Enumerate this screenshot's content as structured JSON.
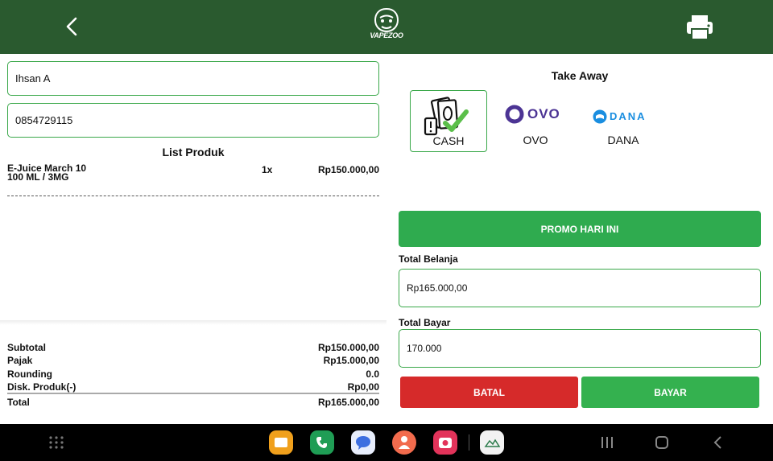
{
  "header": {
    "logo_text": "VAPEZOO",
    "back_icon": "chevron-left-icon",
    "print_icon": "printer-icon"
  },
  "customer": {
    "name": "Ihsan A",
    "phone": "0854729115"
  },
  "product_list": {
    "title": "List Produk",
    "items": [
      {
        "name_line1": "E-Juice March 10",
        "name_line2": "100 ML / 3MG",
        "qty": "1x",
        "price": "Rp150.000,00"
      }
    ]
  },
  "summary": {
    "rows": [
      {
        "label": "Subtotal",
        "value": "Rp150.000,00"
      },
      {
        "label": "Pajak",
        "value": "Rp15.000,00"
      },
      {
        "label": "Rounding",
        "value": "0.0"
      },
      {
        "label": "Disk. Produk(-)",
        "value": "Rp0,00"
      },
      {
        "label": "Total",
        "value": "Rp165.000,00"
      }
    ]
  },
  "order_type": "Take Away",
  "payment_methods": [
    {
      "label": "CASH",
      "selected": true,
      "icon": "cash-icon"
    },
    {
      "label": "OVO",
      "selected": false,
      "icon": "ovo-logo",
      "logo_text": "OVO"
    },
    {
      "label": "DANA",
      "selected": false,
      "icon": "dana-logo",
      "logo_text": "DANA"
    }
  ],
  "promo_button": "PROMO HARI INI",
  "total_belanja": {
    "label": "Total Belanja",
    "value": "Rp165.000,00"
  },
  "total_bayar": {
    "label": "Total Bayar",
    "value": "170.000"
  },
  "actions": {
    "cancel": "BATAL",
    "pay": "BAYAR"
  },
  "colors": {
    "header": "#2a5a2f",
    "accent": "#3aa84a",
    "promo": "#2fab4f",
    "cancel": "#d62a2a",
    "pay": "#34b14f"
  },
  "system_nav": {
    "apps": [
      "files-app-icon",
      "phone-app-icon",
      "messages-app-icon",
      "contacts-app-icon",
      "camera-app-icon",
      "gallery-app-icon"
    ],
    "buttons": [
      "recents-icon",
      "home-icon",
      "back-icon"
    ]
  }
}
